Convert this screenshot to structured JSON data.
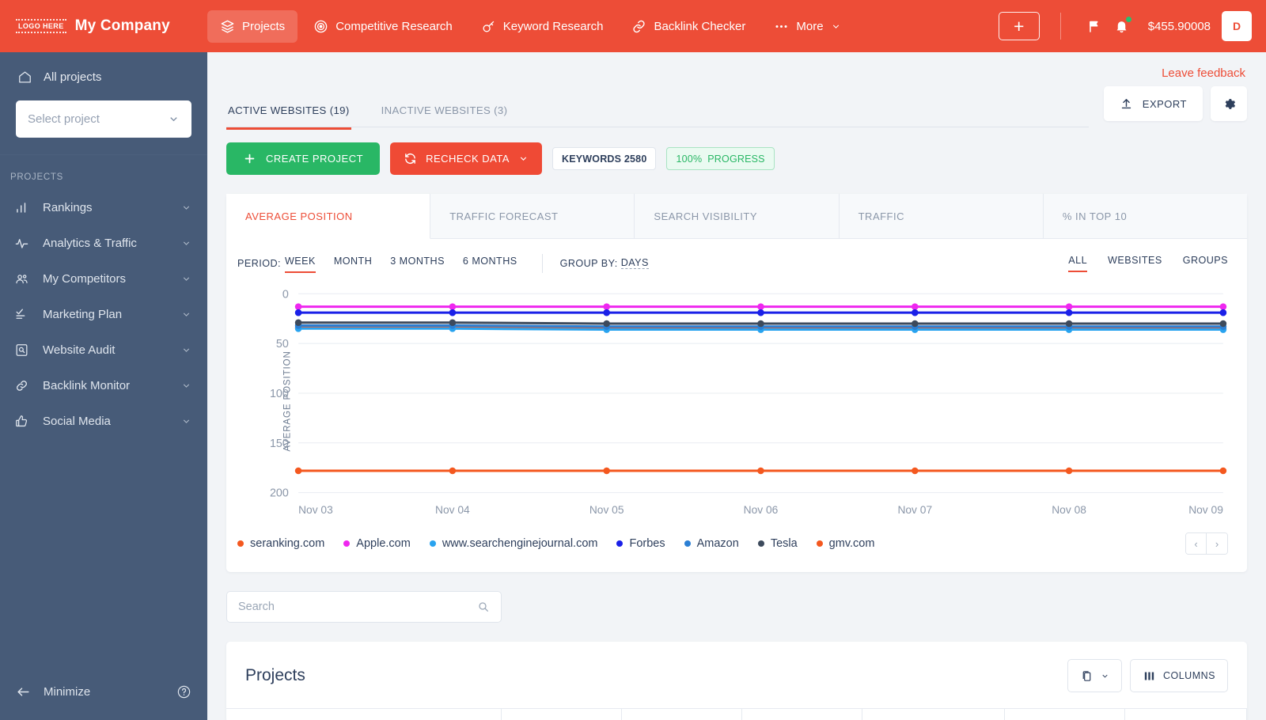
{
  "brand": {
    "logo_text": "LOGO HERE",
    "name": "My Company"
  },
  "topnav": {
    "items": [
      {
        "label": "Projects",
        "icon": "layers-icon",
        "active": true
      },
      {
        "label": "Competitive Research",
        "icon": "target-icon",
        "active": false
      },
      {
        "label": "Keyword Research",
        "icon": "key-icon",
        "active": false
      },
      {
        "label": "Backlink Checker",
        "icon": "link-icon",
        "active": false
      },
      {
        "label": "More",
        "icon": "dots-icon",
        "active": false
      }
    ],
    "add_label": "+",
    "balance": "$455.90008",
    "avatar_initial": "D",
    "flag_icon": "flag-icon",
    "bell_icon": "bell-icon"
  },
  "sidebar": {
    "all_projects": "All projects",
    "select_project_placeholder": "Select project",
    "section_label": "PROJECTS",
    "items": [
      {
        "label": "Rankings",
        "icon": "bar-chart-icon"
      },
      {
        "label": "Analytics & Traffic",
        "icon": "pulse-icon"
      },
      {
        "label": "My Competitors",
        "icon": "people-icon"
      },
      {
        "label": "Marketing Plan",
        "icon": "checklist-icon"
      },
      {
        "label": "Website Audit",
        "icon": "audit-icon"
      },
      {
        "label": "Backlink Monitor",
        "icon": "chain-icon"
      },
      {
        "label": "Social Media",
        "icon": "thumbs-up-icon"
      }
    ],
    "minimize": "Minimize",
    "help_icon": "question-circle-icon"
  },
  "main": {
    "feedback": "Leave feedback",
    "tabs": [
      {
        "label": "ACTIVE WEBSITES (19)",
        "active": true
      },
      {
        "label": "INACTIVE WEBSITES (3)",
        "active": false
      }
    ],
    "export_label": "EXPORT",
    "settings_icon": "gear-icon",
    "create_project": "CREATE PROJECT",
    "recheck_data": "RECHECK DATA",
    "keywords_chip": "KEYWORDS 2580",
    "progress_pct": "100%",
    "progress_label": "PROGRESS"
  },
  "chart_card": {
    "tabs": [
      {
        "label": "AVERAGE POSITION",
        "active": true
      },
      {
        "label": "TRAFFIC FORECAST",
        "active": false
      },
      {
        "label": "SEARCH VISIBILITY",
        "active": false
      },
      {
        "label": "TRAFFIC",
        "active": false
      },
      {
        "label": "% IN TOP 10",
        "active": false
      }
    ],
    "period_label": "PERIOD:",
    "periods": [
      {
        "label": "WEEK",
        "active": true
      },
      {
        "label": "MONTH",
        "active": false
      },
      {
        "label": "3 MONTHS",
        "active": false
      },
      {
        "label": "6 MONTHS",
        "active": false
      }
    ],
    "group_by_label": "GROUP BY:",
    "group_by_value": "DAYS",
    "scope": [
      {
        "label": "ALL",
        "active": true
      },
      {
        "label": "WEBSITES",
        "active": false
      },
      {
        "label": "GROUPS",
        "active": false
      }
    ],
    "pager_prev": "‹",
    "pager_next": "›"
  },
  "chart_data": {
    "type": "line",
    "title": "",
    "xlabel": "",
    "ylabel": "AVERAGE POSITION",
    "x": [
      "Nov 03",
      "Nov 04",
      "Nov 05",
      "Nov 06",
      "Nov 07",
      "Nov 08",
      "Nov 09"
    ],
    "ylim": [
      0,
      200
    ],
    "y_ticks": [
      0,
      50,
      100,
      150,
      200
    ],
    "y_inverted": false,
    "grid": true,
    "legend_position": "bottom",
    "series": [
      {
        "name": "seranking.com",
        "color": "#f4581f",
        "values": [
          34,
          34,
          35,
          35,
          35,
          35,
          35
        ]
      },
      {
        "name": "Apple.com",
        "color": "#ef27ef",
        "values": [
          13,
          13,
          13,
          13,
          13,
          13,
          13
        ]
      },
      {
        "name": "www.searchenginejournal.com",
        "color": "#29a3ef",
        "values": [
          35,
          35,
          36,
          36,
          36,
          36,
          36
        ]
      },
      {
        "name": "Forbes",
        "color": "#1a20e8",
        "values": [
          19,
          19,
          19,
          19,
          19,
          19,
          19
        ]
      },
      {
        "name": "Amazon",
        "color": "#2b7fd4",
        "values": [
          32,
          32,
          33,
          33,
          33,
          33,
          33
        ]
      },
      {
        "name": "Tesla",
        "color": "#3d4a5c",
        "values": [
          29,
          29,
          30,
          30,
          30,
          30,
          30
        ]
      },
      {
        "name": "gmv.com",
        "color": "#f4581f",
        "values": [
          178,
          178,
          178,
          178,
          178,
          178,
          178
        ]
      }
    ]
  },
  "search": {
    "placeholder": "Search",
    "value": "",
    "icon": "search-icon"
  },
  "projects_panel": {
    "title": "Projects",
    "view_icon": "copy-icon",
    "columns_label": "COLUMNS",
    "columns_icon": "columns-icon"
  }
}
